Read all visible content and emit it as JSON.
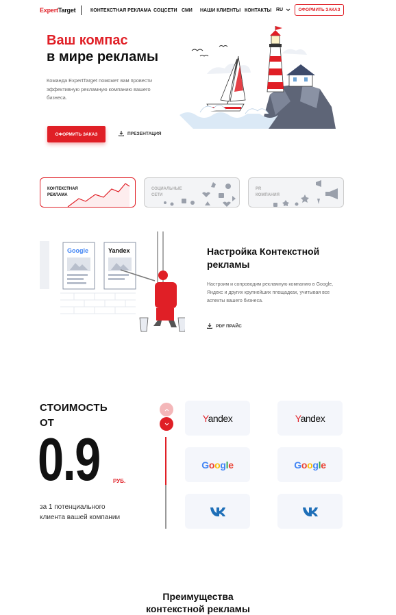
{
  "header": {
    "logo_prefix": "Expert",
    "logo_suffix": "Target",
    "nav": [
      {
        "label": "КОНТЕКСТНАЯ РЕКЛАМА"
      },
      {
        "label": "СОЦСЕТИ"
      },
      {
        "label": "СМИ"
      },
      {
        "label": "НАШИ КЛИЕНТЫ"
      },
      {
        "label": "КОНТАКТЫ"
      }
    ],
    "lang": "RU",
    "order_button": "ОФОРМИТЬ ЗАКАЗ"
  },
  "hero": {
    "title_line1": "Ваш компас",
    "title_line2": "в мире рекламы",
    "text": "Команда ExpertTarget поможет вам провести эффективную рекламную компанию вашего бизнеса.",
    "order_button": "ОФОРМИТЬ ЗАКАЗ",
    "presentation_link": "ПРЕЗЕНТАЦИЯ"
  },
  "service_cards": [
    {
      "line1": "КОНТЕКСТНАЯ",
      "line2": "РЕКЛАМА",
      "active": true
    },
    {
      "line1": "СОЦИАЛЬНЫЕ",
      "line2": "СЕТИ",
      "active": false
    },
    {
      "line1": "PR",
      "line2": "КОМПАНИЯ",
      "active": false
    }
  ],
  "context_section": {
    "title_line1": "Настройка Контекстной",
    "title_line2": "рекламы",
    "text": "Настроим и сопроводим рекламную компанию в Google, Яндекс и других крупнейших площадках, учитывая все аспекты вашего бизнеса.",
    "pdf_link": "PDF ПРАЙС",
    "illustration_labels": {
      "google": "Google",
      "yandex": "Yandex"
    }
  },
  "price": {
    "line1": "СТОИМОСТЬ",
    "line2": "ОТ",
    "value": "0.9",
    "currency": "РУБ.",
    "note": "за 1 потенциального клиента вашей компании",
    "slider_progress": 0.52
  },
  "platform_tiles": [
    {
      "type": "yandex",
      "text_first": "Y",
      "text_rest": "andex"
    },
    {
      "type": "yandex",
      "text_first": "Y",
      "text_rest": "andex"
    },
    {
      "type": "google",
      "text": "Google"
    },
    {
      "type": "google",
      "text": "Google"
    },
    {
      "type": "vk",
      "icon": "vk-icon"
    },
    {
      "type": "vk",
      "icon": "vk-icon"
    }
  ],
  "advantages": {
    "title_line1": "Преимущества",
    "title_line2": "контекстной рекламы"
  },
  "colors": {
    "accent": "#e01f26",
    "accent_light": "#f4b7b9",
    "tile_bg": "#f4f6fb",
    "google_blue": "#4285F4",
    "google_red": "#EA4335",
    "google_yellow": "#FBBC05",
    "google_green": "#34A853"
  }
}
